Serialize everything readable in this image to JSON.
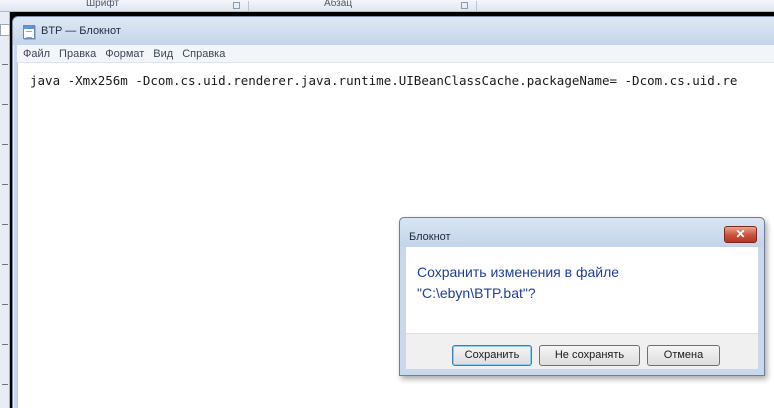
{
  "background": {
    "ribbon_groups": [
      "Шрифт",
      "Абзац"
    ]
  },
  "notepad": {
    "title": "BTP — Блокнот",
    "menu": [
      "Файл",
      "Правка",
      "Формат",
      "Вид",
      "Справка"
    ],
    "content": "java -Xmx256m -Dcom.cs.uid.renderer.java.runtime.UIBeanClassCache.packageName= -Dcom.cs.uid.re"
  },
  "dialog": {
    "title": "Блокнот",
    "close_glyph": "✕",
    "message_line1": "Сохранить изменения в файле",
    "message_line2": "\"C:\\ebyn\\BTP.bat\"?",
    "buttons": {
      "save": "Сохранить",
      "dont_save": "Не сохранять",
      "cancel": "Отмена"
    }
  },
  "colors": {
    "message_text": "#1d3f9a",
    "close_button": "#c8513a",
    "default_button_border": "#3c7fb1"
  }
}
